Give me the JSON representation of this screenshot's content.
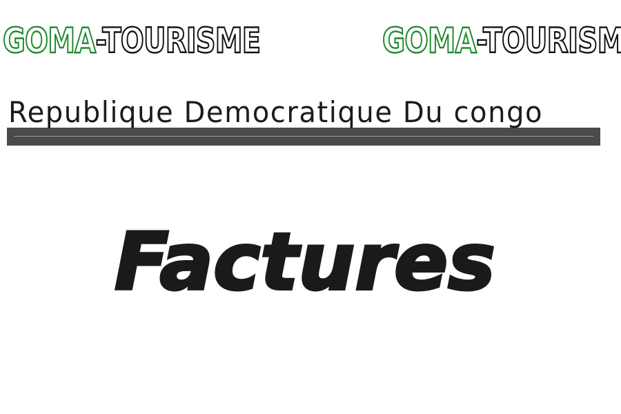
{
  "logos": {
    "left": {
      "goma": "GOMA",
      "tourisme": "-TOURISME"
    },
    "right": {
      "goma": "GOMA",
      "tourisme": "-TOURISME"
    }
  },
  "header": {
    "country": "Republique Democratique Du congo"
  },
  "main": {
    "title": "Factures"
  },
  "colors": {
    "goma_green": "#1f8a2e",
    "outline_black": "#111111",
    "banner_gray": "#4a4a4a",
    "title_black": "#1c1a18"
  }
}
